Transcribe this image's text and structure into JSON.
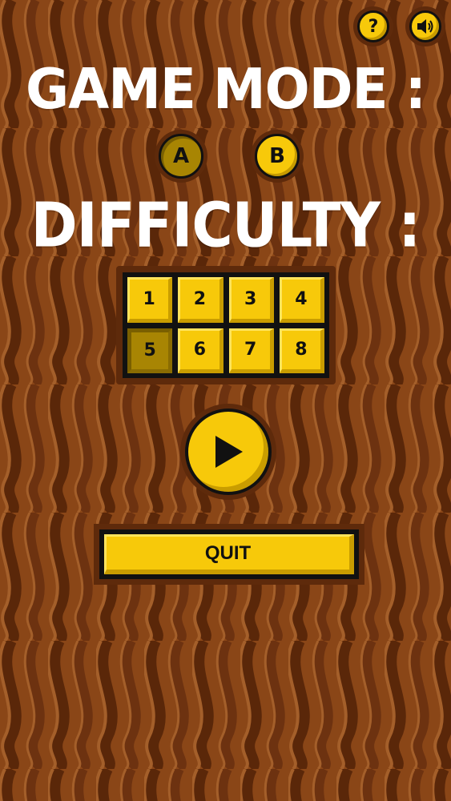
{
  "top_bar": {
    "help_label": "?",
    "sound_icon": "speaker-icon"
  },
  "game_mode": {
    "heading": "GAME MODE :",
    "options": [
      "A",
      "B"
    ],
    "selected": "A"
  },
  "difficulty": {
    "heading": "DIFFICULTY :",
    "levels": [
      "1",
      "2",
      "3",
      "4",
      "5",
      "6",
      "7",
      "8"
    ],
    "selected": "5"
  },
  "play": {
    "icon": "play-icon"
  },
  "quit": {
    "label": "QUIT"
  },
  "colors": {
    "background": "#8a4617",
    "button_yellow": "#f7c90a",
    "button_selected": "#a88503",
    "frame": "#5e2a0b",
    "heading": "#ffffff"
  }
}
